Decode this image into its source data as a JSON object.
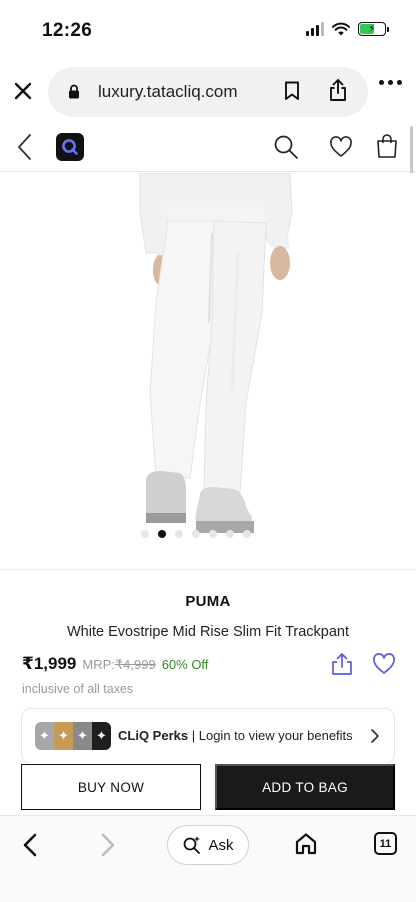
{
  "status_bar": {
    "time": "12:26"
  },
  "browser": {
    "url": "luxury.tatacliq.com",
    "ask_label": "Ask",
    "tab_count": "11",
    "icons": {
      "close": "close-icon",
      "lock": "lock-icon",
      "bookmark": "bookmark-icon",
      "share": "share-icon",
      "more": "more-icon",
      "back": "back-arrow-icon",
      "forward": "forward-arrow-icon",
      "ask": "sparkle-search-icon",
      "home": "home-icon",
      "tabs": "tabs-icon"
    }
  },
  "site_header": {
    "logo_letter": "Q",
    "icons": {
      "back": "chevron-left-icon",
      "search": "search-icon",
      "wishlist": "heart-icon",
      "bag": "shopping-bag-icon"
    }
  },
  "product": {
    "image_carousel": {
      "total": 7,
      "active_index": 1
    },
    "brand": "PUMA",
    "name": "White Evostripe Mid Rise Slim Fit Trackpant",
    "price": "₹1,999",
    "mrp_label": "MRP:",
    "mrp_value": "₹4,999",
    "discount": "60% Off",
    "tax_note": "inclusive of all taxes"
  },
  "perks": {
    "title": "CLiQ Perks",
    "separator": "|",
    "subtitle": "Login to view your benefits",
    "badge_glyph": "✦"
  },
  "actions": {
    "buy_now": "BUY NOW",
    "add_to_bag": "ADD TO BAG"
  },
  "colors": {
    "accent_purple": "#5b5bd6",
    "discount_green": "#2e8b2e",
    "cta_dark": "#1a1a1a",
    "battery_green": "#34c759"
  }
}
